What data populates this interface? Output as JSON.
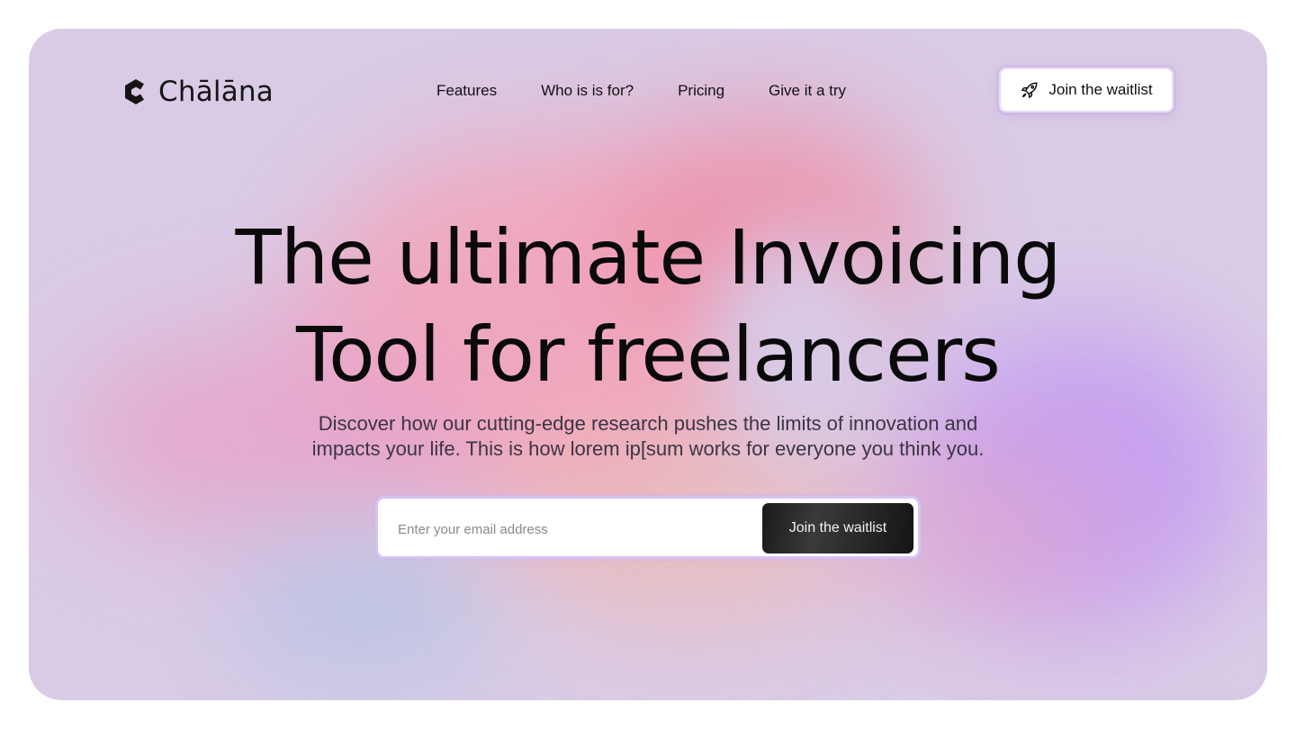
{
  "brand": {
    "name": "Chālāna",
    "icon": "logo-c-icon"
  },
  "nav": {
    "items": [
      {
        "label": "Features"
      },
      {
        "label": "Who is is for?"
      },
      {
        "label": "Pricing"
      },
      {
        "label": "Give it a try"
      }
    ]
  },
  "header_cta": {
    "label": "Join the waitlist",
    "icon": "rocket-icon"
  },
  "hero": {
    "headline_line1": "The ultimate Invoicing",
    "headline_line2": "Tool for freelancers",
    "subtitle_line1": "Discover how our cutting-edge research pushes the limits of innovation and",
    "subtitle_line2": "impacts your life. This is how lorem ip[sum works for everyone you think you."
  },
  "signup": {
    "email_placeholder": "Enter your email address",
    "email_value": "",
    "button_label": "Join the waitlist"
  },
  "colors": {
    "background": "#d9cbe6",
    "text": "#0a0a0a",
    "button_dark": "#1a1a1a",
    "accent_pink": "#ef8ea6",
    "accent_purple": "#c49af2"
  }
}
